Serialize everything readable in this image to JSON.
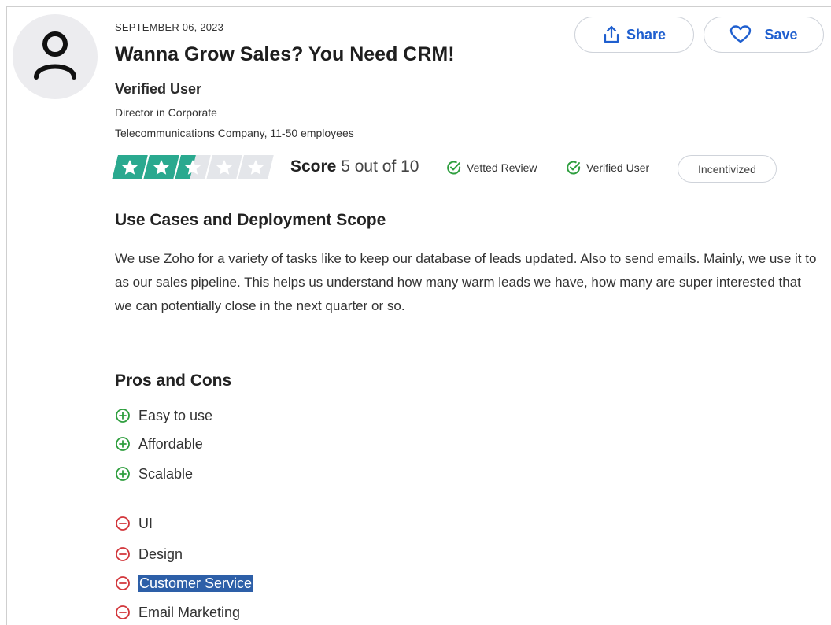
{
  "review": {
    "date": "SEPTEMBER 06, 2023",
    "title": "Wanna Grow Sales? You Need CRM!",
    "reviewer_name": "Verified User",
    "reviewer_role": "Director in Corporate",
    "reviewer_company": "Telecommunications Company, 11-50 employees",
    "rating": {
      "stars_total": 5,
      "stars_filled": 2.5
    },
    "score_label": "Score",
    "score_value": "5 out of 10",
    "badges": {
      "vetted": "Vetted Review",
      "verified": "Verified User",
      "incentivized": "Incentivized"
    }
  },
  "actions": {
    "share_label": "Share",
    "save_label": "Save"
  },
  "use_cases": {
    "heading": "Use Cases and Deployment Scope",
    "text": "We use Zoho for a variety of tasks like to keep our database of leads updated. Also to send emails. Mainly, we use it to as our sales pipeline. This helps us understand how many warm leads we have, how many are super interested that we can potentially close in the next quarter or so."
  },
  "pros_cons": {
    "heading": "Pros and Cons",
    "pros": [
      "Easy to use",
      "Affordable",
      "Scalable"
    ],
    "cons": [
      "UI",
      "Design",
      "Customer Service",
      "Email Marketing"
    ],
    "selected_con": "Customer Service"
  },
  "colors": {
    "accent_blue": "#1f5fcf",
    "star_green": "#2aa98f",
    "pro_green": "#2e9e3e",
    "con_red": "#d2353a",
    "selection": "#2d5fa8"
  },
  "icons": {
    "avatar": "user-icon",
    "share": "share-icon",
    "save": "heart-icon",
    "check": "check-circle-icon",
    "pro": "plus-circle-icon",
    "con": "minus-circle-icon",
    "star": "star-icon"
  }
}
